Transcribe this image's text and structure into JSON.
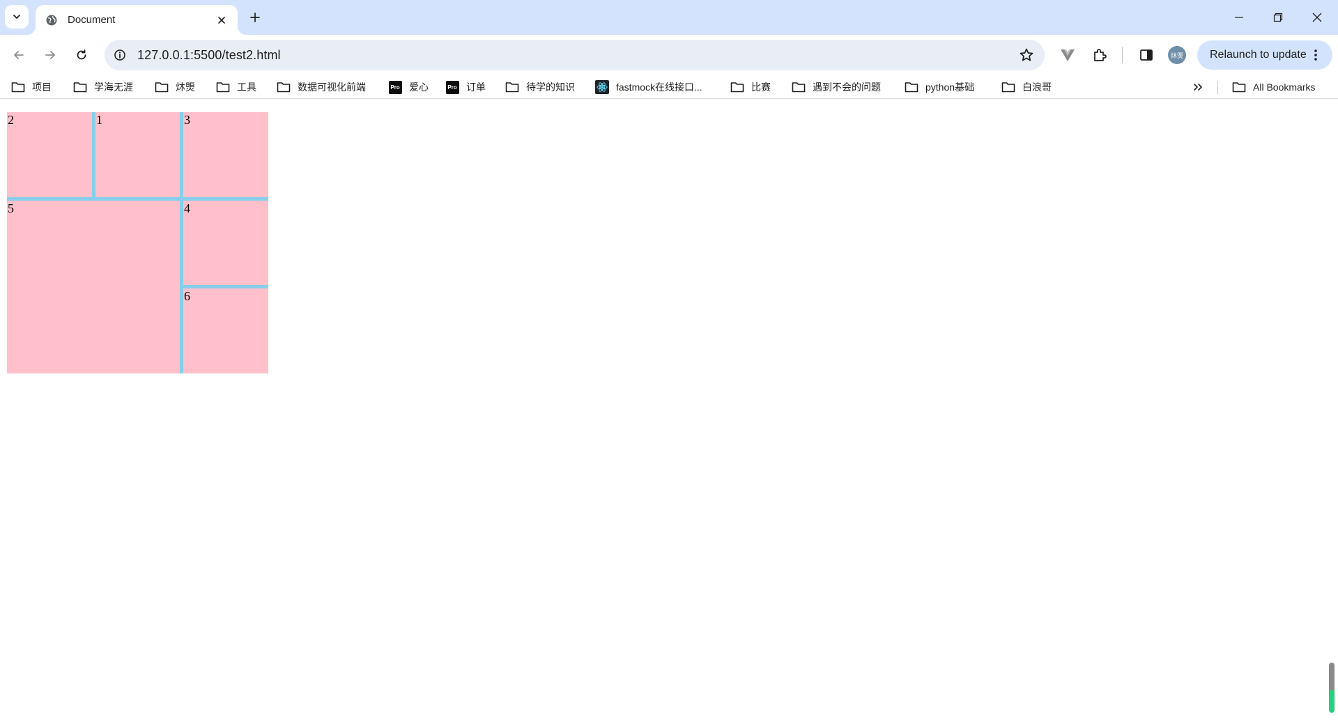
{
  "tab": {
    "title": "Document"
  },
  "toolbar": {
    "url": "127.0.0.1:5500/test2.html",
    "avatar_text": "炑煚",
    "relaunch_label": "Relaunch to update"
  },
  "bookmarks": {
    "items": [
      {
        "label": "项目",
        "icon": "folder-icon"
      },
      {
        "label": "学海无涯",
        "icon": "folder-icon"
      },
      {
        "label": "炑煚",
        "icon": "folder-icon"
      },
      {
        "label": "工具",
        "icon": "folder-icon"
      },
      {
        "label": "数据可视化前端",
        "icon": "folder-icon"
      },
      {
        "label": "爱心",
        "icon": "pro-icon"
      },
      {
        "label": "订单",
        "icon": "pro-icon"
      },
      {
        "label": "待学的知识",
        "icon": "folder-icon"
      },
      {
        "label": "fastmock在线接口...",
        "icon": "react-icon"
      },
      {
        "label": "比赛",
        "icon": "folder-icon"
      },
      {
        "label": "遇到不会的问题",
        "icon": "folder-icon"
      },
      {
        "label": "python基础",
        "icon": "folder-icon"
      },
      {
        "label": "白浪哥",
        "icon": "folder-icon"
      }
    ],
    "pro_badge_text": "Pro",
    "all_bookmarks_label": "All Bookmarks"
  },
  "page": {
    "cells": [
      "2",
      "1",
      "3",
      "5",
      "4",
      "6"
    ]
  },
  "colors": {
    "cell_bg": "#ffc0cb",
    "gap_bg": "#87ceeb",
    "tabstrip_bg": "#d3e3fd",
    "omnibox_bg": "#e9eef6"
  }
}
